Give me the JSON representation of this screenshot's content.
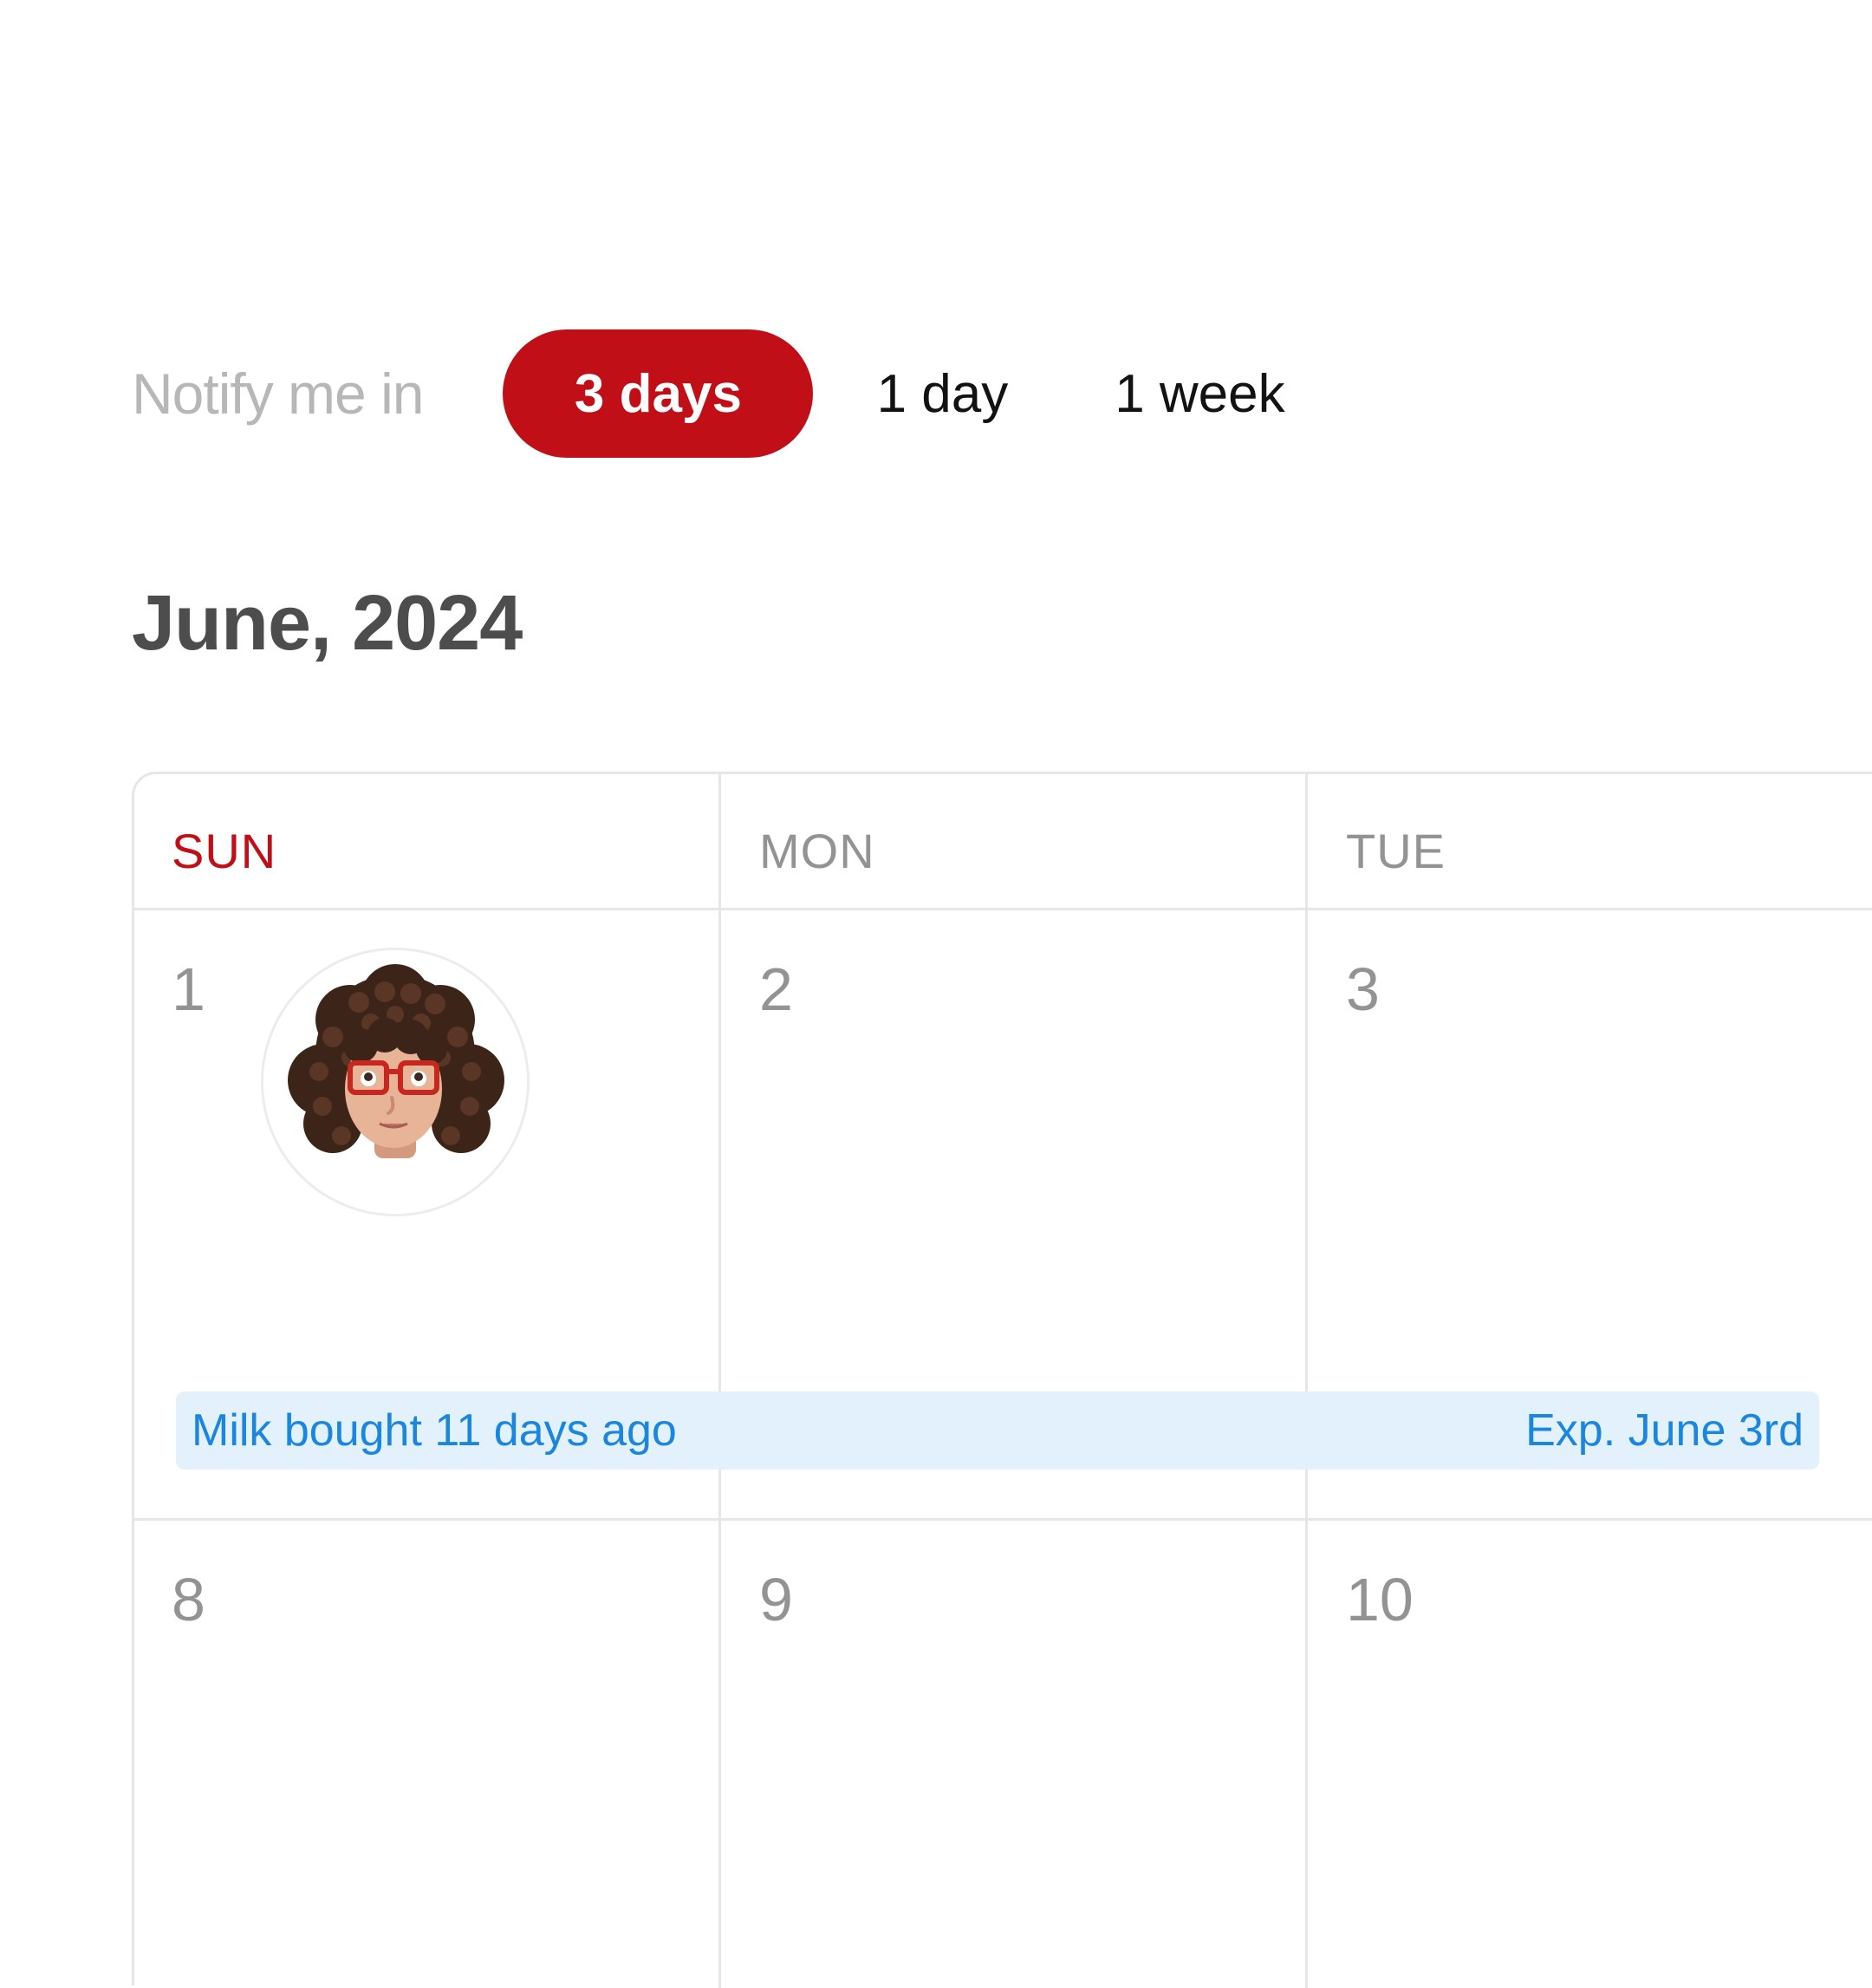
{
  "notify": {
    "label": "Notify me in",
    "options": [
      {
        "label": "3 days",
        "selected": true
      },
      {
        "label": "1 day",
        "selected": false
      },
      {
        "label": "1 week",
        "selected": false
      }
    ]
  },
  "calendar": {
    "month_title": "June, 2024",
    "weekdays": [
      "SUN",
      "MON",
      "TUE"
    ],
    "rows": [
      [
        "1",
        "2",
        "3"
      ],
      [
        "8",
        "9",
        "10"
      ]
    ],
    "event": {
      "left_text": "Milk bought 11 days ago",
      "right_text": "Exp. June 3rd"
    }
  },
  "colors": {
    "accent": "#c10f17",
    "event_bg": "#e3f1fc",
    "event_text": "#1a86e0"
  },
  "icons": {
    "avatar": "memoji-avatar"
  }
}
